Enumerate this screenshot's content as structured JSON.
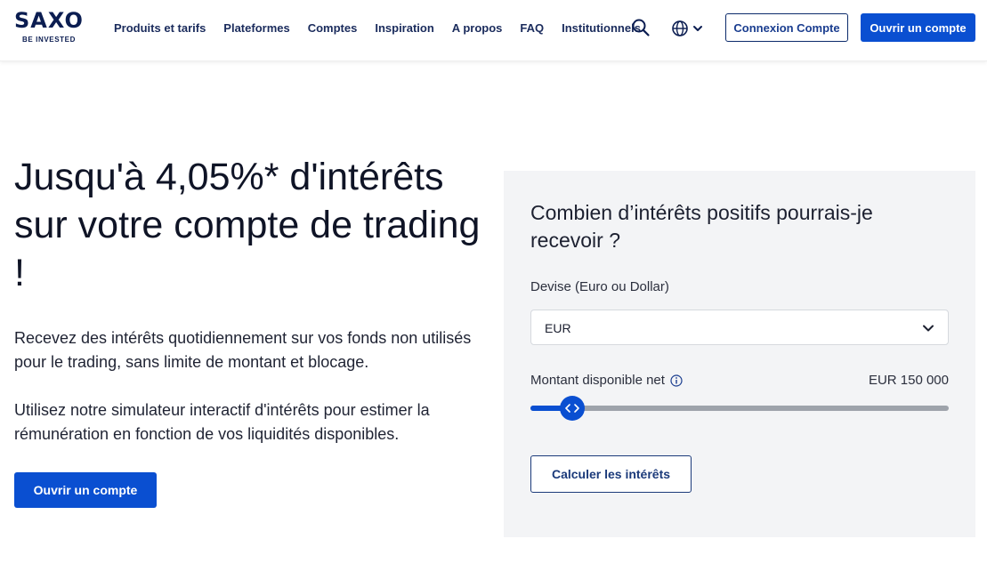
{
  "header": {
    "logo": {
      "name": "SAXO",
      "tagline": "BE INVESTED"
    },
    "nav": [
      {
        "label": "Produits et tarifs"
      },
      {
        "label": "Plateformes"
      },
      {
        "label": "Comptes"
      },
      {
        "label": "Inspiration"
      },
      {
        "label": "A propos"
      },
      {
        "label": "FAQ"
      },
      {
        "label": "Institutionnels"
      }
    ],
    "search_icon": "search-icon",
    "language_icon": "globe-icon",
    "login_label": "Connexion Compte",
    "open_account_label": "Ouvrir un compte"
  },
  "hero": {
    "title": "Jusqu'à 4,05%* d'intérêts sur votre compte de trading !",
    "paragraph1": "Recevez des intérêts quotidiennement sur vos fonds non utilisés pour le trading, sans limite de montant et blocage.",
    "paragraph2": "Utilisez notre simulateur interactif d'intérêts pour estimer la rémunération en fonction de vos liquidités disponibles.",
    "cta_label": "Ouvrir un compte"
  },
  "simulator": {
    "title": "Combien d’intérêts positifs pourrais-je recevoir ?",
    "currency_label": "Devise (Euro ou Dollar)",
    "currency_value": "EUR",
    "amount_label": "Montant disponible net",
    "amount_value": "EUR 150 000",
    "slider_fraction": 0.1,
    "calculate_label": "Calculer les intérêts"
  },
  "colors": {
    "brand_blue": "#0a4fd1",
    "navy": "#0b1d51",
    "card_bg": "#f3f4f6"
  }
}
